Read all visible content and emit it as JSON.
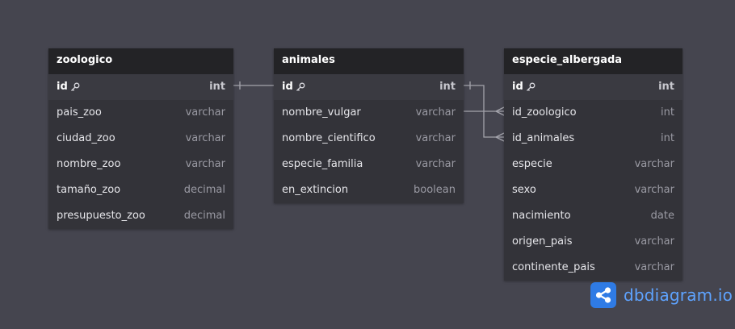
{
  "tables": {
    "zoologico": {
      "name": "zoologico",
      "columns": [
        {
          "name": "id",
          "type": "int",
          "pk": true
        },
        {
          "name": "pais_zoo",
          "type": "varchar"
        },
        {
          "name": "ciudad_zoo",
          "type": "varchar"
        },
        {
          "name": "nombre_zoo",
          "type": "varchar"
        },
        {
          "name": "tamaño_zoo",
          "type": "decimal"
        },
        {
          "name": "presupuesto_zoo",
          "type": "decimal"
        }
      ]
    },
    "animales": {
      "name": "animales",
      "columns": [
        {
          "name": "id",
          "type": "int",
          "pk": true
        },
        {
          "name": "nombre_vulgar",
          "type": "varchar"
        },
        {
          "name": "nombre_cientifico",
          "type": "varchar"
        },
        {
          "name": "especie_familia",
          "type": "varchar"
        },
        {
          "name": "en_extincion",
          "type": "boolean"
        }
      ]
    },
    "especie_albergada": {
      "name": "especie_albergada",
      "columns": [
        {
          "name": "id",
          "type": "int",
          "pk": true
        },
        {
          "name": "id_zoologico",
          "type": "int"
        },
        {
          "name": "id_animales",
          "type": "int"
        },
        {
          "name": "especie",
          "type": "varchar"
        },
        {
          "name": "sexo",
          "type": "varchar"
        },
        {
          "name": "nacimiento",
          "type": "date"
        },
        {
          "name": "origen_pais",
          "type": "varchar"
        },
        {
          "name": "continente_pais",
          "type": "varchar"
        }
      ]
    }
  },
  "relationships": [
    {
      "from": "zoologico.id",
      "to": "animales.id",
      "cardinality": "one-to-one"
    },
    {
      "from": "animales.id",
      "to": "especie_albergada.id_animales",
      "cardinality": "one-to-many"
    },
    {
      "from": "animales.nombre_vulgar",
      "to": "especie_albergada.id_zoologico",
      "cardinality": "one-to-many"
    }
  ],
  "brand": {
    "text": "dbdiagram.io",
    "color": "#2f7be5"
  },
  "colors": {
    "background": "#45454f",
    "header": "#232326",
    "body": "#333339",
    "line": "#9a9aa3"
  }
}
